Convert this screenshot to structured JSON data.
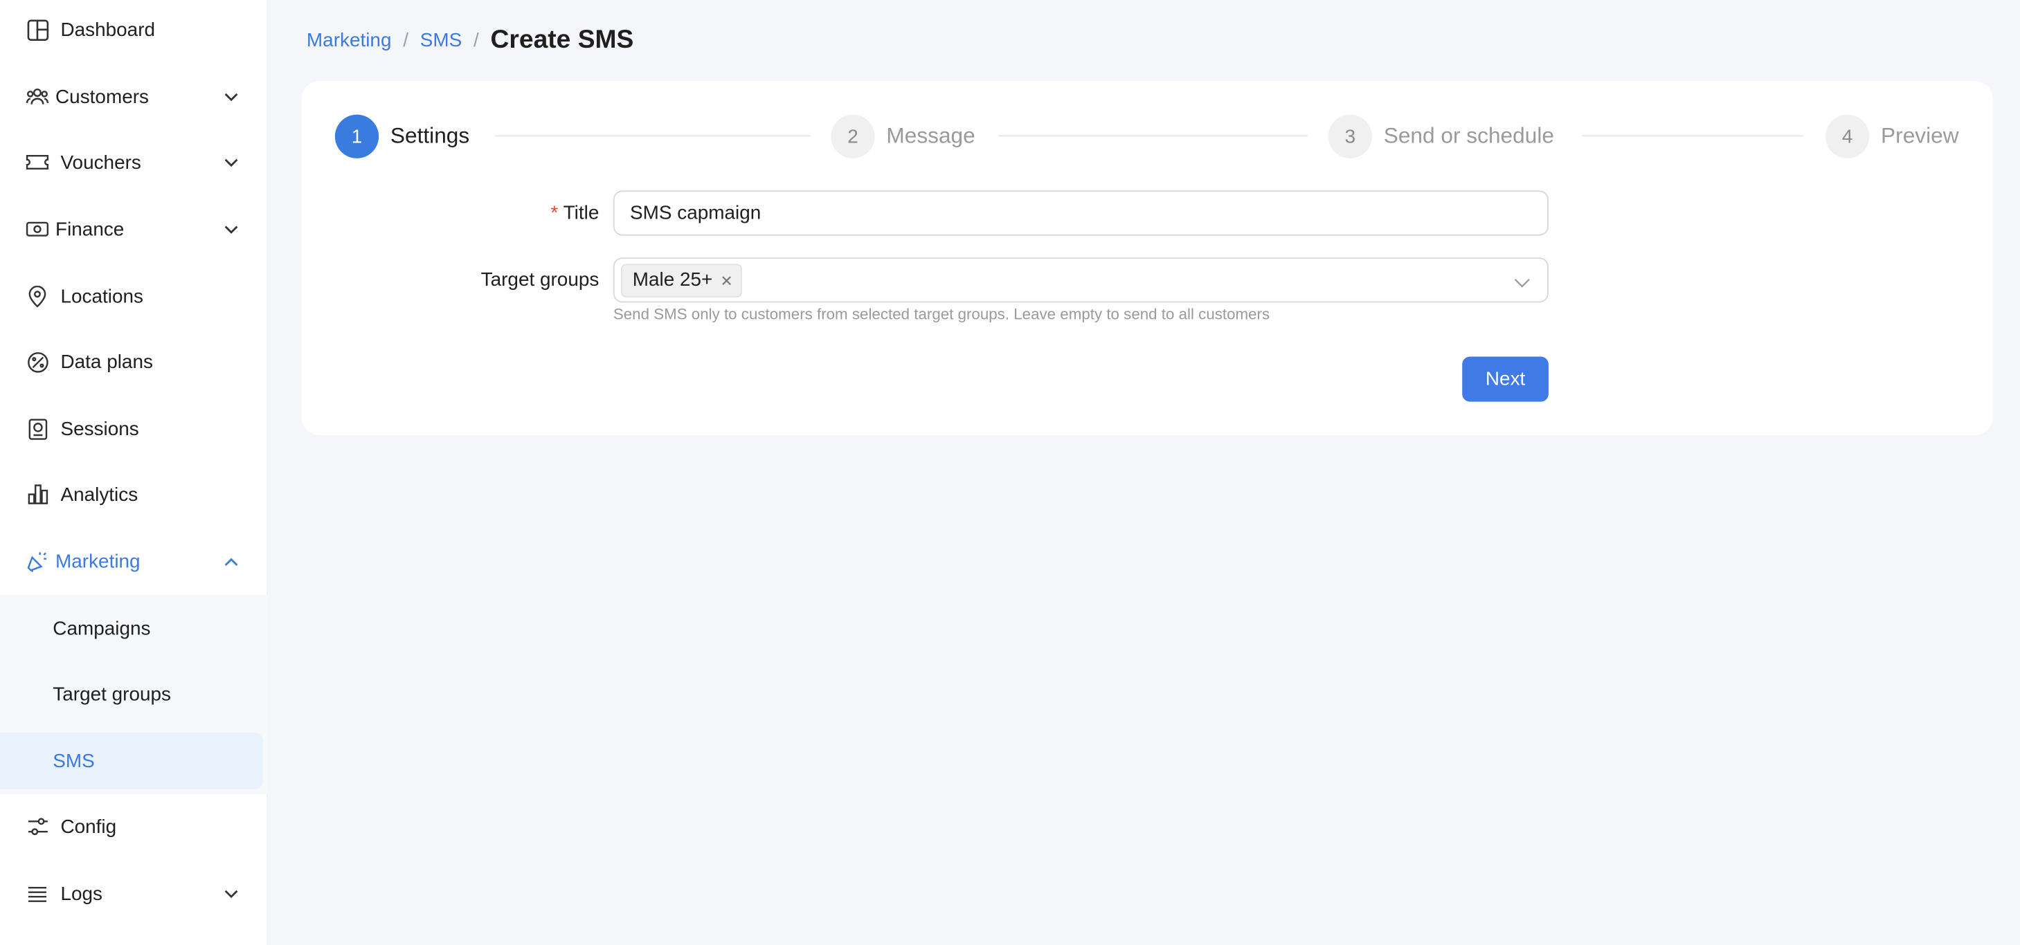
{
  "sidebar": {
    "items": [
      {
        "label": "Dashboard",
        "icon": "dashboard-icon"
      },
      {
        "label": "Customers",
        "icon": "customers-icon"
      },
      {
        "label": "Vouchers",
        "icon": "voucher-icon"
      },
      {
        "label": "Finance",
        "icon": "finance-icon"
      },
      {
        "label": "Locations",
        "icon": "location-pin-icon"
      },
      {
        "label": "Data plans",
        "icon": "data-plan-icon"
      },
      {
        "label": "Sessions",
        "icon": "sessions-icon"
      },
      {
        "label": "Analytics",
        "icon": "analytics-icon"
      },
      {
        "label": "Marketing",
        "icon": "marketing-icon"
      },
      {
        "label": "Config",
        "icon": "config-sliders-icon"
      },
      {
        "label": "Logs",
        "icon": "logs-list-icon"
      }
    ],
    "marketing_sub": [
      {
        "label": "Campaigns"
      },
      {
        "label": "Target groups"
      },
      {
        "label": "SMS"
      }
    ]
  },
  "breadcrumb": {
    "items": [
      "Marketing",
      "SMS"
    ],
    "current": "Create SMS",
    "separator": "/"
  },
  "steps": [
    {
      "number": "1",
      "title": "Settings"
    },
    {
      "number": "2",
      "title": "Message"
    },
    {
      "number": "3",
      "title": "Send or schedule"
    },
    {
      "number": "4",
      "title": "Preview"
    }
  ],
  "form": {
    "title_label": "Title",
    "required_mark": "*",
    "title_value": "SMS capmaign",
    "target_groups_label": "Target groups",
    "selected_tag": "Male 25+",
    "help_text": "Send SMS only to customers from selected target groups. Leave empty to send to all customers"
  },
  "next_button": "Next",
  "colors": {
    "accent": "#3a7be0",
    "background": "#f5f6fa",
    "required": "#e0473f"
  }
}
